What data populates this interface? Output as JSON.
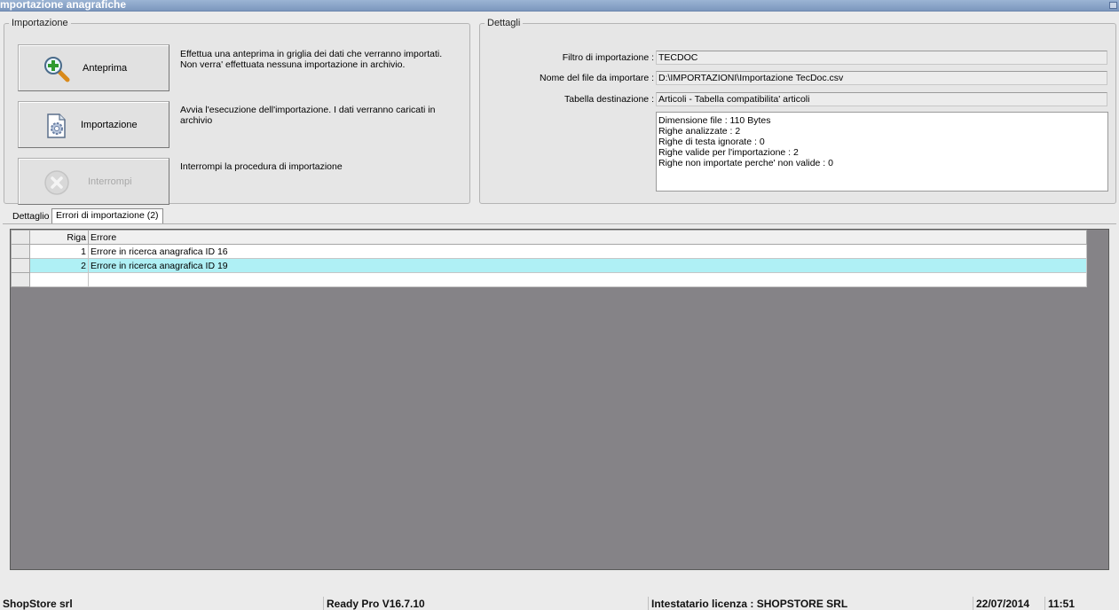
{
  "window": {
    "title": "mportazione anagrafiche"
  },
  "importazione": {
    "legend": "Importazione",
    "buttons": [
      {
        "label": "Anteprima",
        "icon": "magnifier-plus-icon",
        "enabled": true,
        "description": "Effettua una anteprima in griglia dei dati che verranno importati. Non verra' effettuata nessuna importazione in archivio."
      },
      {
        "label": "Importazione",
        "icon": "document-gear-icon",
        "enabled": true,
        "description": "Avvia l'esecuzione dell'importazione. I dati verranno caricati in archivio"
      },
      {
        "label": "Interrompi",
        "icon": "stop-x-icon",
        "enabled": false,
        "description": "Interrompi la procedura di importazione"
      }
    ]
  },
  "dettagli": {
    "legend": "Dettagli",
    "fields": [
      {
        "label": "Filtro di importazione :",
        "value": "TECDOC"
      },
      {
        "label": "Nome del file da importare :",
        "value": "D:\\IMPORTAZIONI\\Importazione TecDoc.csv"
      },
      {
        "label": "Tabella destinazione :",
        "value": "Articoli - Tabella compatibilita' articoli"
      }
    ],
    "summary": [
      "Dimensione file : 110 Bytes",
      "Righe analizzate : 2",
      "Righe di testa ignorate : 0",
      "Righe valide per l'importazione : 2",
      "Righe non importate perche' non valide : 0"
    ]
  },
  "tabs": [
    {
      "label": "Dettaglio",
      "active": false
    },
    {
      "label": "Errori di importazione (2)",
      "active": true
    }
  ],
  "grid": {
    "columns": [
      "Riga",
      "Errore"
    ],
    "rows": [
      {
        "riga": "1",
        "errore": "Errore in ricerca anagrafica ID 16",
        "selected": false
      },
      {
        "riga": "2",
        "errore": "Errore in ricerca anagrafica ID 19",
        "selected": true
      }
    ]
  },
  "statusbar": {
    "company": "ShopStore srl",
    "version": "Ready Pro V16.7.10",
    "license": "Intestatario licenza : SHOPSTORE SRL",
    "date": "22/07/2014",
    "time": "11:51"
  },
  "colors": {
    "titlebar": "#7c97bd",
    "selected_row": "#aff0f5",
    "grid_background": "#858387"
  }
}
